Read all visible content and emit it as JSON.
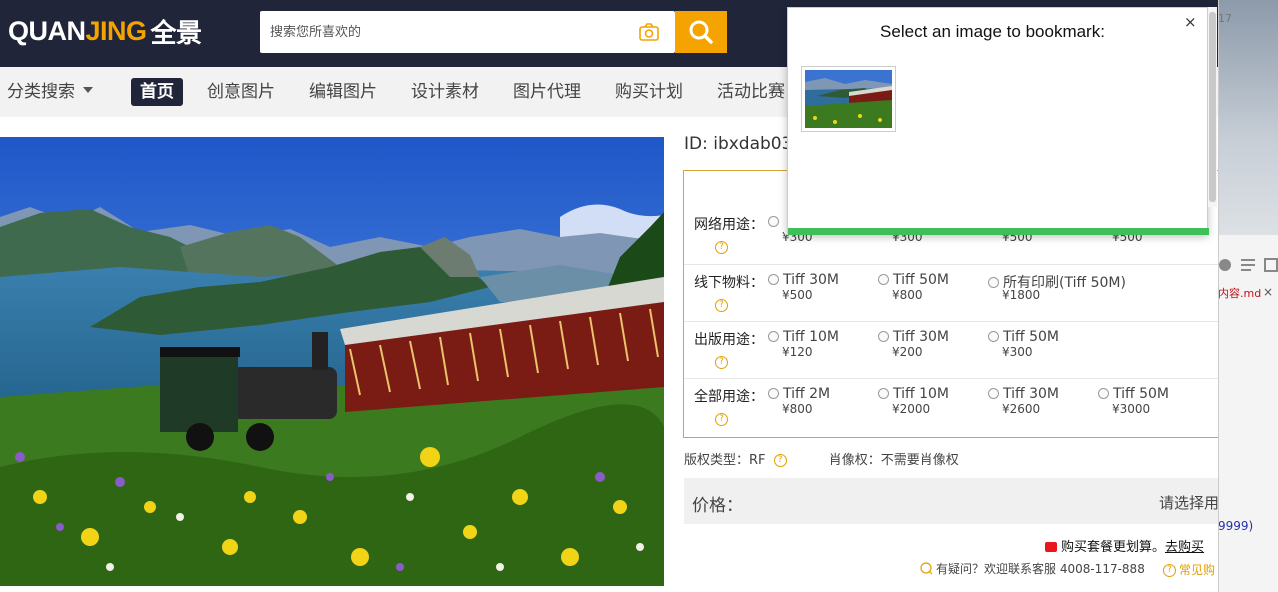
{
  "header": {
    "logo_latin_white_1": "QUAN",
    "logo_latin_orange": "JING",
    "logo_cn": "全景",
    "search_placeholder": "搜索您所喜欢的"
  },
  "nav": {
    "category_label": "分类搜索",
    "items": [
      "首页",
      "创意图片",
      "编辑图片",
      "设计素材",
      "图片代理",
      "购买计划",
      "活动比赛"
    ]
  },
  "detail": {
    "image_id": "ID: ibxdab03",
    "rows": [
      {
        "label": "网络用途：",
        "options": [
          {
            "name": "",
            "price": "¥300"
          },
          {
            "name": "",
            "price": "¥300"
          },
          {
            "name": "",
            "price": "¥500"
          },
          {
            "name": "",
            "price": "¥500"
          }
        ]
      },
      {
        "label": "线下物料：",
        "options": [
          {
            "name": "Tiff 30M",
            "price": "¥500"
          },
          {
            "name": "Tiff 50M",
            "price": "¥800"
          },
          {
            "name": "所有印刷(Tiff 50M)",
            "price": "¥1800"
          }
        ]
      },
      {
        "label": "出版用途：",
        "options": [
          {
            "name": "Tiff 10M",
            "price": "¥120"
          },
          {
            "name": "Tiff 30M",
            "price": "¥200"
          },
          {
            "name": "Tiff 50M",
            "price": "¥300"
          }
        ]
      },
      {
        "label": "全部用途：",
        "options": [
          {
            "name": "Tiff 2M",
            "price": "¥800"
          },
          {
            "name": "Tiff 10M",
            "price": "¥2000"
          },
          {
            "name": "Tiff 30M",
            "price": "¥2600"
          },
          {
            "name": "Tiff 50M",
            "price": "¥3000"
          }
        ]
      }
    ],
    "copyright_label": "版权类型：RF",
    "portrait_label": "肖像权：不需要肖像权",
    "price_label": "价格：",
    "price_hint": "请选择用",
    "promo_text": "购买套餐更划算。",
    "promo_link": "去购买",
    "contact_text": "有疑问？欢迎联系客服 4008-117-888",
    "faq_text": "常见购"
  },
  "sidebar": {
    "text_number": "17",
    "text_red": "内容.md",
    "text_close": "×",
    "text_blue": "9999)"
  },
  "popup": {
    "title": "Select an image to bookmark:",
    "close_label": "×"
  },
  "colors": {
    "header_bg": "#20253a",
    "accent_orange": "#f4a300",
    "progress_green": "#3fbf58"
  }
}
